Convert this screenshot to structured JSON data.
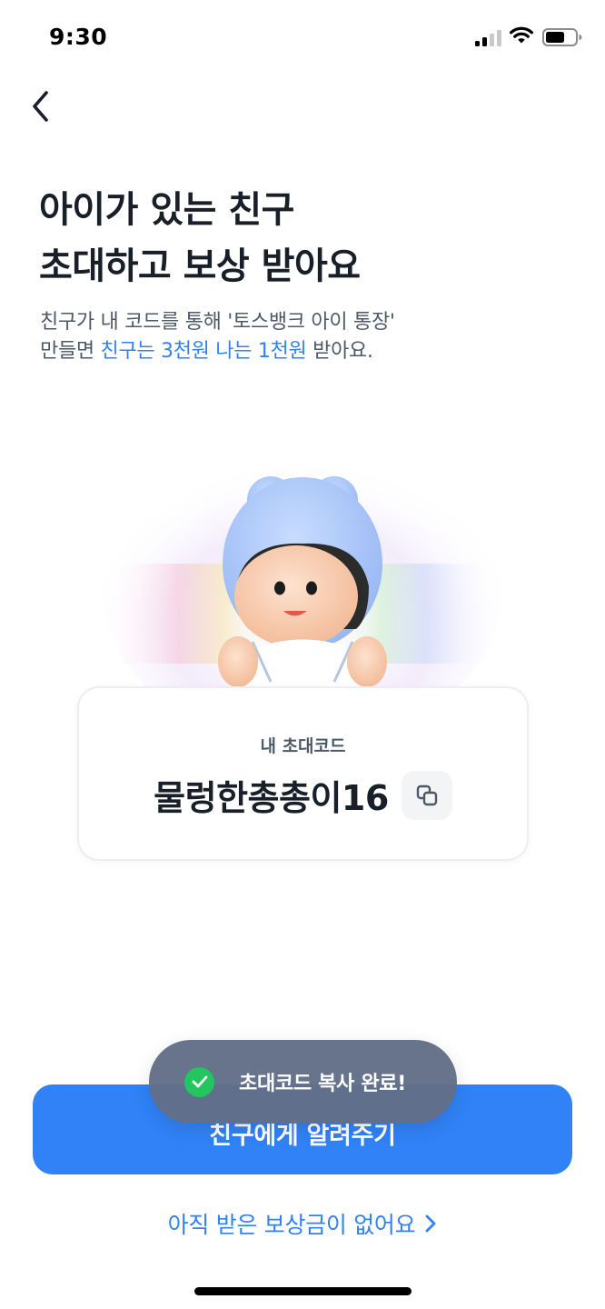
{
  "status_bar": {
    "time": "9:30",
    "icons": [
      "signal-icon",
      "wifi-icon",
      "battery-icon"
    ],
    "battery_level": 0.6
  },
  "nav": {
    "back_icon": "chevron-left-icon"
  },
  "headline": {
    "line1": "아이가 있는 친구",
    "line2": "초대하고 보상 받아요"
  },
  "subtitle": {
    "line1": "친구가 내 코드를 통해 '토스뱅크 아이 통장'",
    "line2_prefix": "만들면 ",
    "line2_highlight": "친구는 3천원 나는 1천원",
    "line2_suffix": " 받아요."
  },
  "hero": {
    "image": "child-character-illustration"
  },
  "invite_card": {
    "label": "내 초대코드",
    "code": "물렁한총총이16",
    "copy_icon": "copy-icon"
  },
  "cta": {
    "label": "친구에게 알려주기"
  },
  "toast": {
    "text": "초대코드 복사 완료!",
    "icon": "check-circle-icon"
  },
  "reward_link": {
    "text": "아직 받은 보상금이 없어요",
    "icon": "chevron-right-icon"
  },
  "colors": {
    "accent": "#3182f6",
    "text_primary": "#191f28",
    "text_secondary": "#4e5968",
    "toast_bg": "#627088",
    "success": "#22c55e"
  }
}
